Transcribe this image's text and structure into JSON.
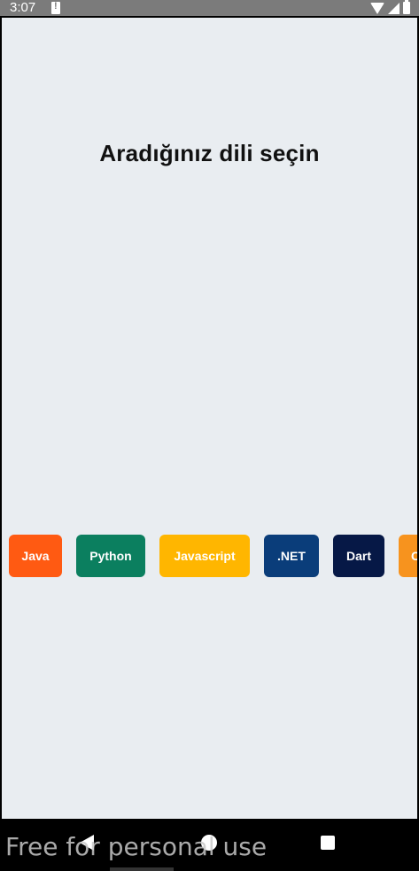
{
  "status_bar": {
    "time": "3:07",
    "icons": [
      "notification-icon",
      "wifi-icon",
      "signal-icon",
      "battery-icon"
    ]
  },
  "main": {
    "title": "Aradığınız dili seçin",
    "chips": [
      {
        "label": "Java",
        "color": "#ff5a12"
      },
      {
        "label": "Python",
        "color": "#0b7f5f"
      },
      {
        "label": "Javascript",
        "color": "#ffb600"
      },
      {
        "label": ".NET",
        "color": "#0a3d7a"
      },
      {
        "label": "Dart",
        "color": "#061846"
      },
      {
        "label": "C",
        "color": "#f7931e"
      }
    ]
  },
  "nav_bar": {
    "icons": [
      "back-icon",
      "home-icon",
      "recents-icon"
    ]
  },
  "watermark": "Free for personal use"
}
